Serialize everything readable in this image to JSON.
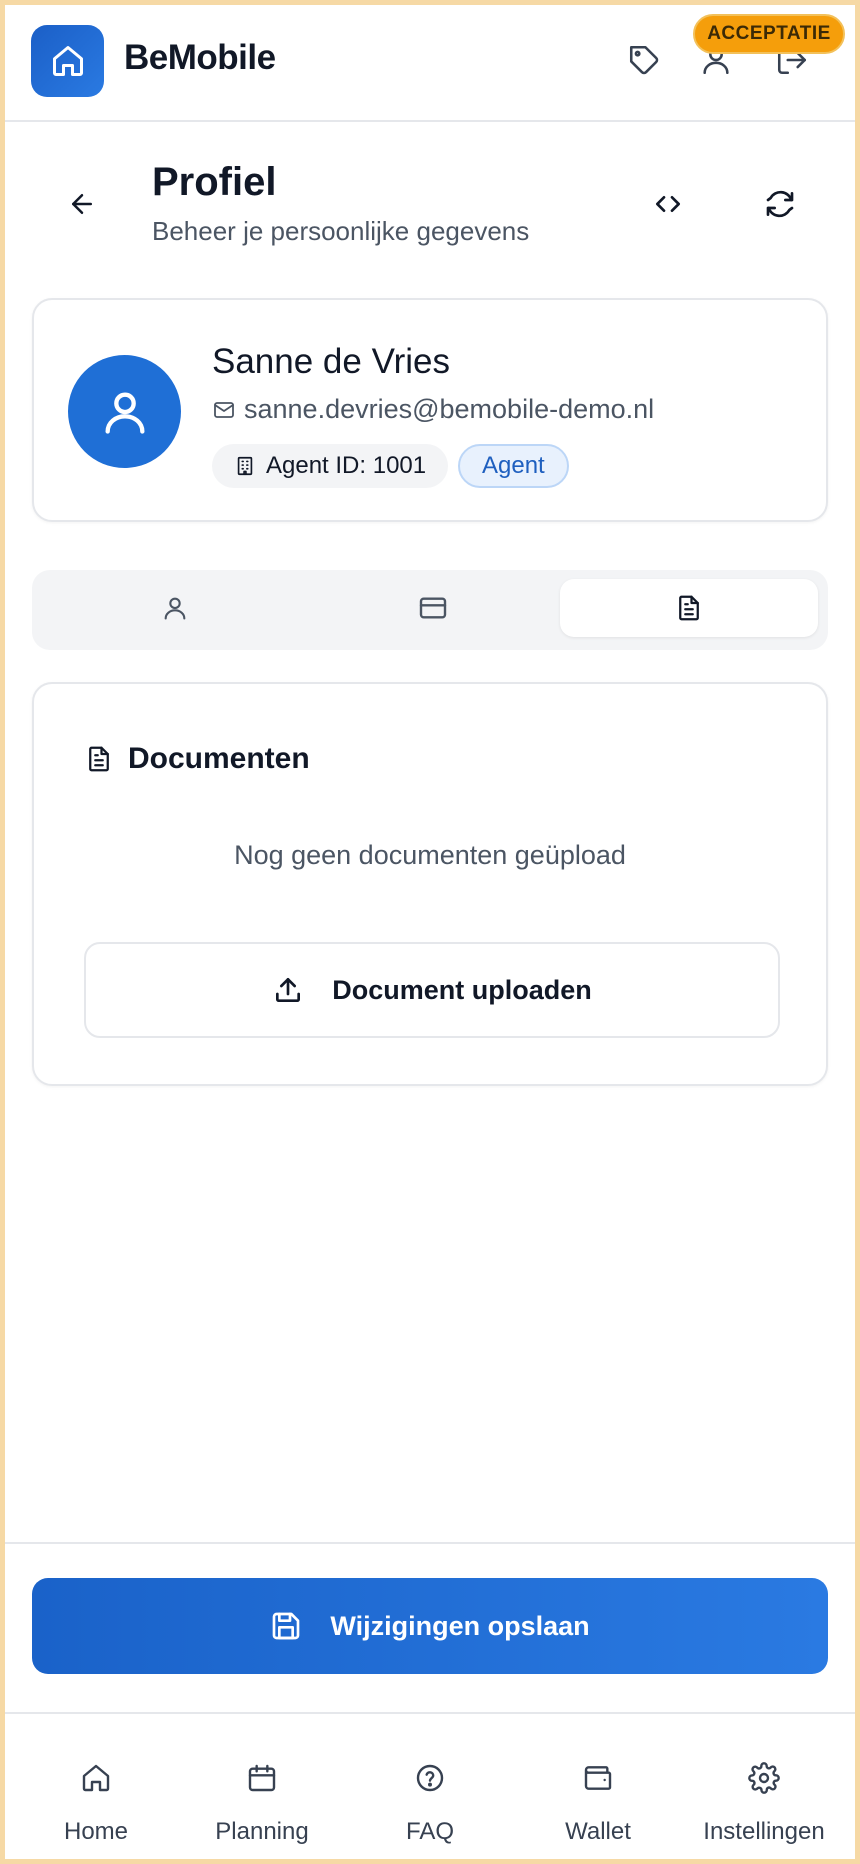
{
  "app": {
    "name": "BeMobile",
    "environment_badge": "ACCEPTATIE",
    "accent_color": "#1f6fd6",
    "badge_color": "#f59e0b"
  },
  "header": {
    "icons": [
      "home-icon",
      "tag-icon",
      "user-icon",
      "logout-icon"
    ]
  },
  "page": {
    "title": "Profiel",
    "subtitle": "Beheer je persoonlijke gegevens",
    "actions": [
      "code-icon",
      "refresh-icon"
    ]
  },
  "profile": {
    "name": "Sanne de Vries",
    "email": "sanne.devries@bemobile-demo.nl",
    "agent_id": "Agent ID: 1001",
    "role": "Agent"
  },
  "tabs": [
    {
      "icon": "user-icon",
      "active": false
    },
    {
      "icon": "credit-card-icon",
      "active": false
    },
    {
      "icon": "document-icon",
      "active": true
    }
  ],
  "documents": {
    "title": "Documenten",
    "empty_text": "Nog geen documenten geüpload",
    "upload_label": "Document uploaden"
  },
  "save": {
    "label": "Wijzigingen opslaan"
  },
  "nav": [
    {
      "label": "Home",
      "icon": "home-icon"
    },
    {
      "label": "Planning",
      "icon": "calendar-icon"
    },
    {
      "label": "FAQ",
      "icon": "help-circle-icon"
    },
    {
      "label": "Wallet",
      "icon": "wallet-icon"
    },
    {
      "label": "Instellingen",
      "icon": "gear-icon"
    }
  ]
}
